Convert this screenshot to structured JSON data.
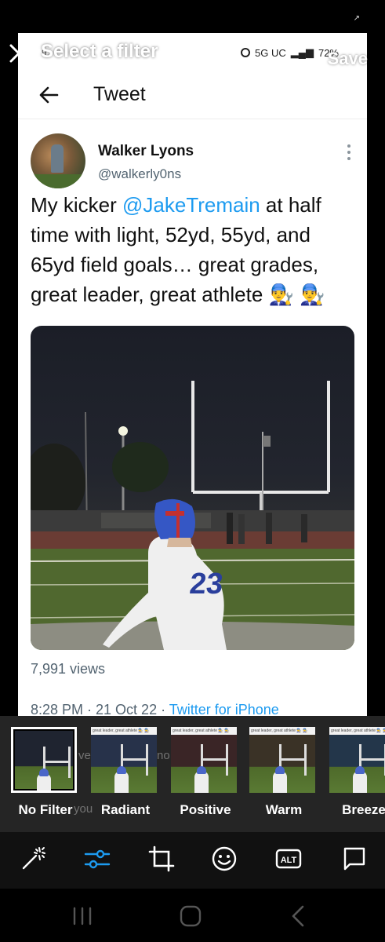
{
  "status": {
    "tiny_indicator": "↗"
  },
  "tweet_page": {
    "system_bar": {
      "time": "9:",
      "network": "5G UC",
      "battery": "72%"
    },
    "header_title": "Tweet",
    "author": {
      "name": "Walker Lyons",
      "handle": "@walkerly0ns"
    },
    "text_prefix": "My kicker ",
    "mention": "@JakeTremain",
    "text_suffix": " at half time with light, 52yd, 55yd, and 65yd field goals… great grades, great leader, great athlete 👨‍🔧 👨‍🔧",
    "media": {
      "jersey_number": "23"
    },
    "views": "7,991 views",
    "meta_time": "8:28 PM · 21 Oct 22 · ",
    "meta_client": "Twitter for iPhone"
  },
  "editor": {
    "title": "Select a filter",
    "save_label": "Save"
  },
  "filters": [
    {
      "label": "No Filter",
      "selected": true,
      "tint": "#1f2430"
    },
    {
      "label": "Radiant",
      "selected": false,
      "tint": "#27324a"
    },
    {
      "label": "Positive",
      "selected": false,
      "tint": "#3a2526"
    },
    {
      "label": "Warm",
      "selected": false,
      "tint": "#3a3226"
    },
    {
      "label": "Breeze",
      "selected": false,
      "tint": "#23364a"
    }
  ],
  "filter_thumb_caption": "great leader, great athlete 👨‍🔧 👨‍🔧",
  "tools": [
    {
      "name": "magic-wand-icon",
      "active": false
    },
    {
      "name": "adjust-sliders-icon",
      "active": true
    },
    {
      "name": "crop-icon",
      "active": false
    },
    {
      "name": "sticker-icon",
      "active": false
    },
    {
      "name": "alt-text-icon",
      "active": false,
      "text": "ALT"
    },
    {
      "name": "flag-icon",
      "active": false
    }
  ],
  "colors": {
    "accent": "#1d9bf0",
    "active_tool": "#1d9bf0"
  }
}
